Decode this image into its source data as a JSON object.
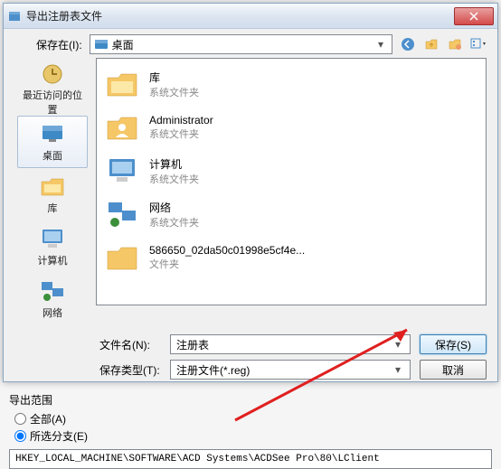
{
  "dialog": {
    "title": "导出注册表文件"
  },
  "toolbar": {
    "save_in_label": "保存在(I):",
    "location": "桌面"
  },
  "places": {
    "recent": "最近访问的位置",
    "desktop": "桌面",
    "libraries": "库",
    "computer": "计算机",
    "network": "网络"
  },
  "files": [
    {
      "name": "库",
      "sub": "系统文件夹",
      "icon": "libraries"
    },
    {
      "name": "Administrator",
      "sub": "系统文件夹",
      "icon": "user-folder"
    },
    {
      "name": "计算机",
      "sub": "系统文件夹",
      "icon": "computer"
    },
    {
      "name": "网络",
      "sub": "系统文件夹",
      "icon": "network"
    },
    {
      "name": "586650_02da50c01998e5cf4e...",
      "sub": "文件夹",
      "icon": "folder"
    }
  ],
  "form": {
    "filename_label": "文件名(N):",
    "filename_value": "注册表",
    "filetype_label": "保存类型(T):",
    "filetype_value": "注册文件(*.reg)",
    "save_btn": "保存(S)",
    "cancel_btn": "取消"
  },
  "export_range": {
    "title": "导出范围",
    "all": "全部(A)",
    "selected": "所选分支(E)",
    "path": "HKEY_LOCAL_MACHINE\\SOFTWARE\\ACD Systems\\ACDSee Pro\\80\\LClient"
  }
}
